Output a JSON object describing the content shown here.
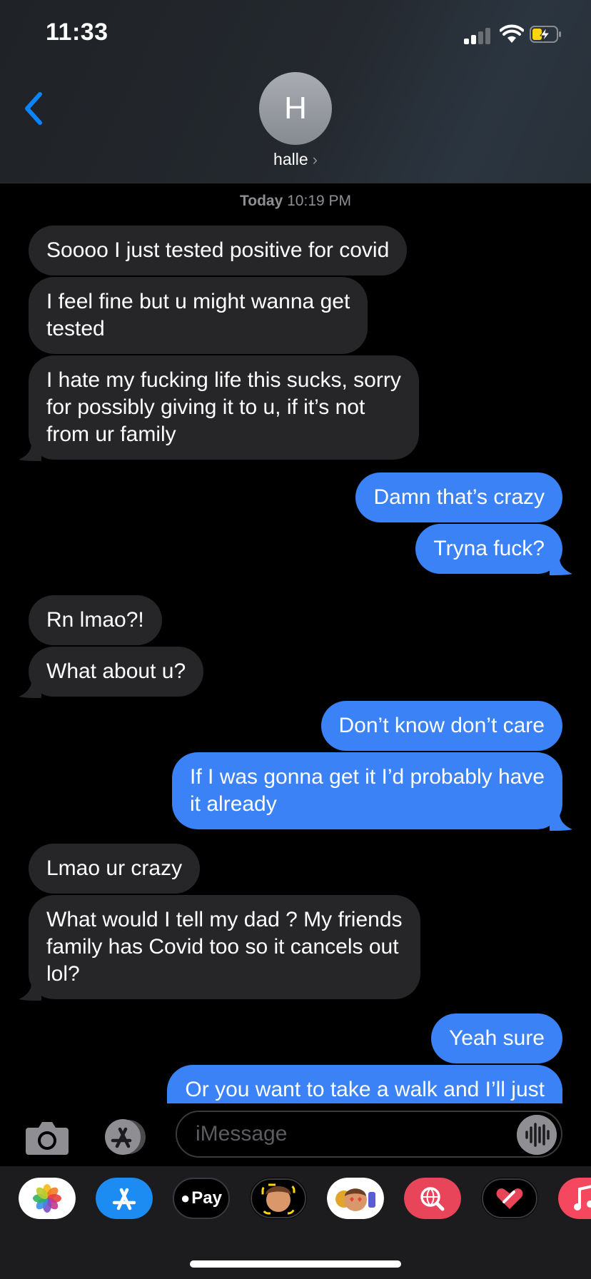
{
  "status_bar": {
    "time": "11:33"
  },
  "header": {
    "avatar_initial": "H",
    "contact_name": "halle"
  },
  "chat": {
    "timestamp_day": "Today",
    "timestamp_time": "10:19 PM",
    "messages": [
      {
        "from": "them",
        "text": "Soooo I just tested positive for covid"
      },
      {
        "from": "them",
        "text": "I feel fine but u might wanna get\ntested"
      },
      {
        "from": "them",
        "text": "I hate my fucking life this sucks, sorry\nfor possibly giving it to u, if it’s not\nfrom ur family"
      },
      {
        "from": "me",
        "text": "Damn that’s crazy"
      },
      {
        "from": "me",
        "text": "Tryna fuck?"
      },
      {
        "from": "them",
        "text": "Rn lmao?!"
      },
      {
        "from": "them",
        "text": "What about u?"
      },
      {
        "from": "me",
        "text": "Don’t know don’t care"
      },
      {
        "from": "me",
        "text": "If I was gonna get it I’d probably have\nit already"
      },
      {
        "from": "them",
        "text": "Lmao ur crazy"
      },
      {
        "from": "them",
        "text": "What would I tell my dad ? My friends\nfamily has Covid too so it cancels out\nlol?"
      },
      {
        "from": "me",
        "text": "Yeah sure"
      },
      {
        "from": "me",
        "text": "Or you want to take a walk and I’ll just"
      }
    ]
  },
  "input": {
    "placeholder": "iMessage"
  },
  "app_drawer": {
    "apps": [
      {
        "icon": "photos-icon"
      },
      {
        "icon": "app-store-icon"
      },
      {
        "icon": "apple-pay-icon",
        "label": "Pay"
      },
      {
        "icon": "memoji-stickers-icon"
      },
      {
        "icon": "animoji-icon"
      },
      {
        "icon": "web-search-icon"
      },
      {
        "icon": "digital-touch-icon"
      },
      {
        "icon": "music-icon"
      }
    ]
  },
  "colors": {
    "incoming_bubble": "#262628",
    "outgoing_bubble": "#3b82f6",
    "accent_blue": "#0a84ff",
    "secondary_text": "#8e8e93"
  }
}
